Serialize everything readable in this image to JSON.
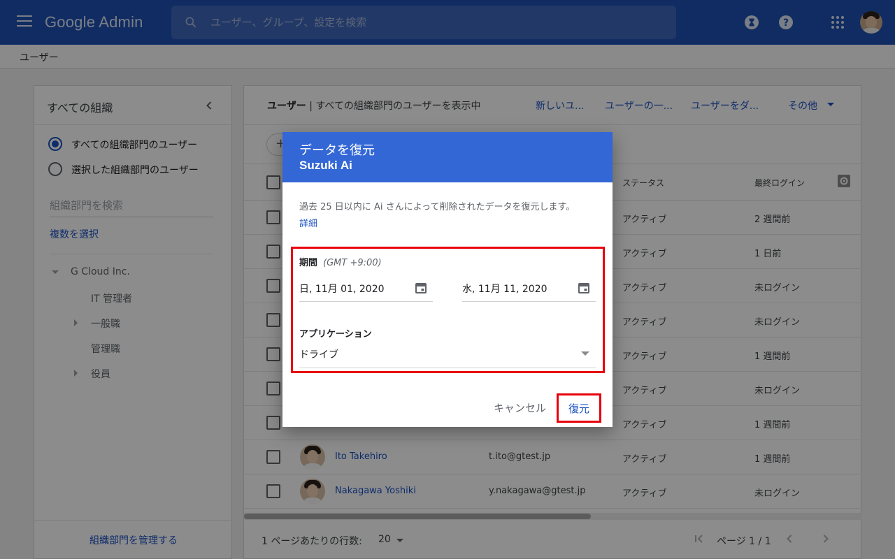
{
  "header": {
    "logo": "Google Admin",
    "search_placeholder": "ユーザー、グループ、設定を検索"
  },
  "breadcrumb": "ユーザー",
  "sidebar": {
    "title": "すべての組織",
    "radio_all": "すべての組織部門のユーザー",
    "radio_selected": "選択した組織部門のユーザー",
    "org_search_placeholder": "組織部門を検索",
    "multi_select": "複数を選択",
    "tree": [
      {
        "label": "G Cloud Inc.",
        "expander": "down"
      },
      {
        "label": "IT 管理者",
        "expander": "none"
      },
      {
        "label": "一般職",
        "expander": "right"
      },
      {
        "label": "管理職",
        "expander": "none"
      },
      {
        "label": "役員",
        "expander": "right"
      }
    ],
    "footer": "組織部門を管理する"
  },
  "main": {
    "title_bold": "ユーザー",
    "title_sub": "| すべての組織部門のユーザーを表示中",
    "actions": [
      "新しいユ...",
      "ユーザーの一...",
      "ユーザーをダ...",
      "その他"
    ],
    "filter_chip": "+",
    "columns": {
      "status": "ステータス",
      "last_login": "最終ログイン"
    },
    "rows": [
      {
        "name": "",
        "email": "",
        "status": "アクティブ",
        "last_login": "2 週間前"
      },
      {
        "name": "",
        "email": "",
        "status": "アクティブ",
        "last_login": "1 日前"
      },
      {
        "name": "",
        "email": "",
        "status": "アクティブ",
        "last_login": "未ログイン"
      },
      {
        "name": "",
        "email": "",
        "status": "アクティブ",
        "last_login": "未ログイン"
      },
      {
        "name": "",
        "email": "",
        "status": "アクティブ",
        "last_login": "1 週間前"
      },
      {
        "name": "",
        "email": "",
        "status": "アクティブ",
        "last_login": "未ログイン"
      },
      {
        "name": "",
        "email": "",
        "status": "アクティブ",
        "last_login": "1 週間前"
      },
      {
        "name": "Ito Takehiro",
        "email": "t.ito@gtest.jp",
        "status": "アクティブ",
        "last_login": "1 週間前"
      },
      {
        "name": "Nakagawa Yoshiki",
        "email": "y.nakagawa@gtest.jp",
        "status": "アクティブ",
        "last_login": "未ログイン"
      }
    ],
    "pager": {
      "rows_per_page_label": "1 ページあたりの行数:",
      "rows_per_page": "20",
      "page": "ページ 1 / 1"
    }
  },
  "dialog": {
    "title": "データを復元",
    "user": "Suzuki Ai",
    "description": "過去 25 日以内に Ai さんによって削除されたデータを復元します。",
    "details_link": "詳細",
    "period_label": "期間",
    "timezone": "(GMT +9:00)",
    "start_date": "日, 11月 01, 2020",
    "end_date": "水, 11月 11, 2020",
    "app_label": "アプリケーション",
    "app_value": "ドライブ",
    "cancel": "キャンセル",
    "restore": "復元"
  },
  "colors": {
    "header_bg": "#1e50b3",
    "dialog_header": "#3367d6",
    "link": "#1a51c2",
    "highlight": "#e8000b"
  }
}
